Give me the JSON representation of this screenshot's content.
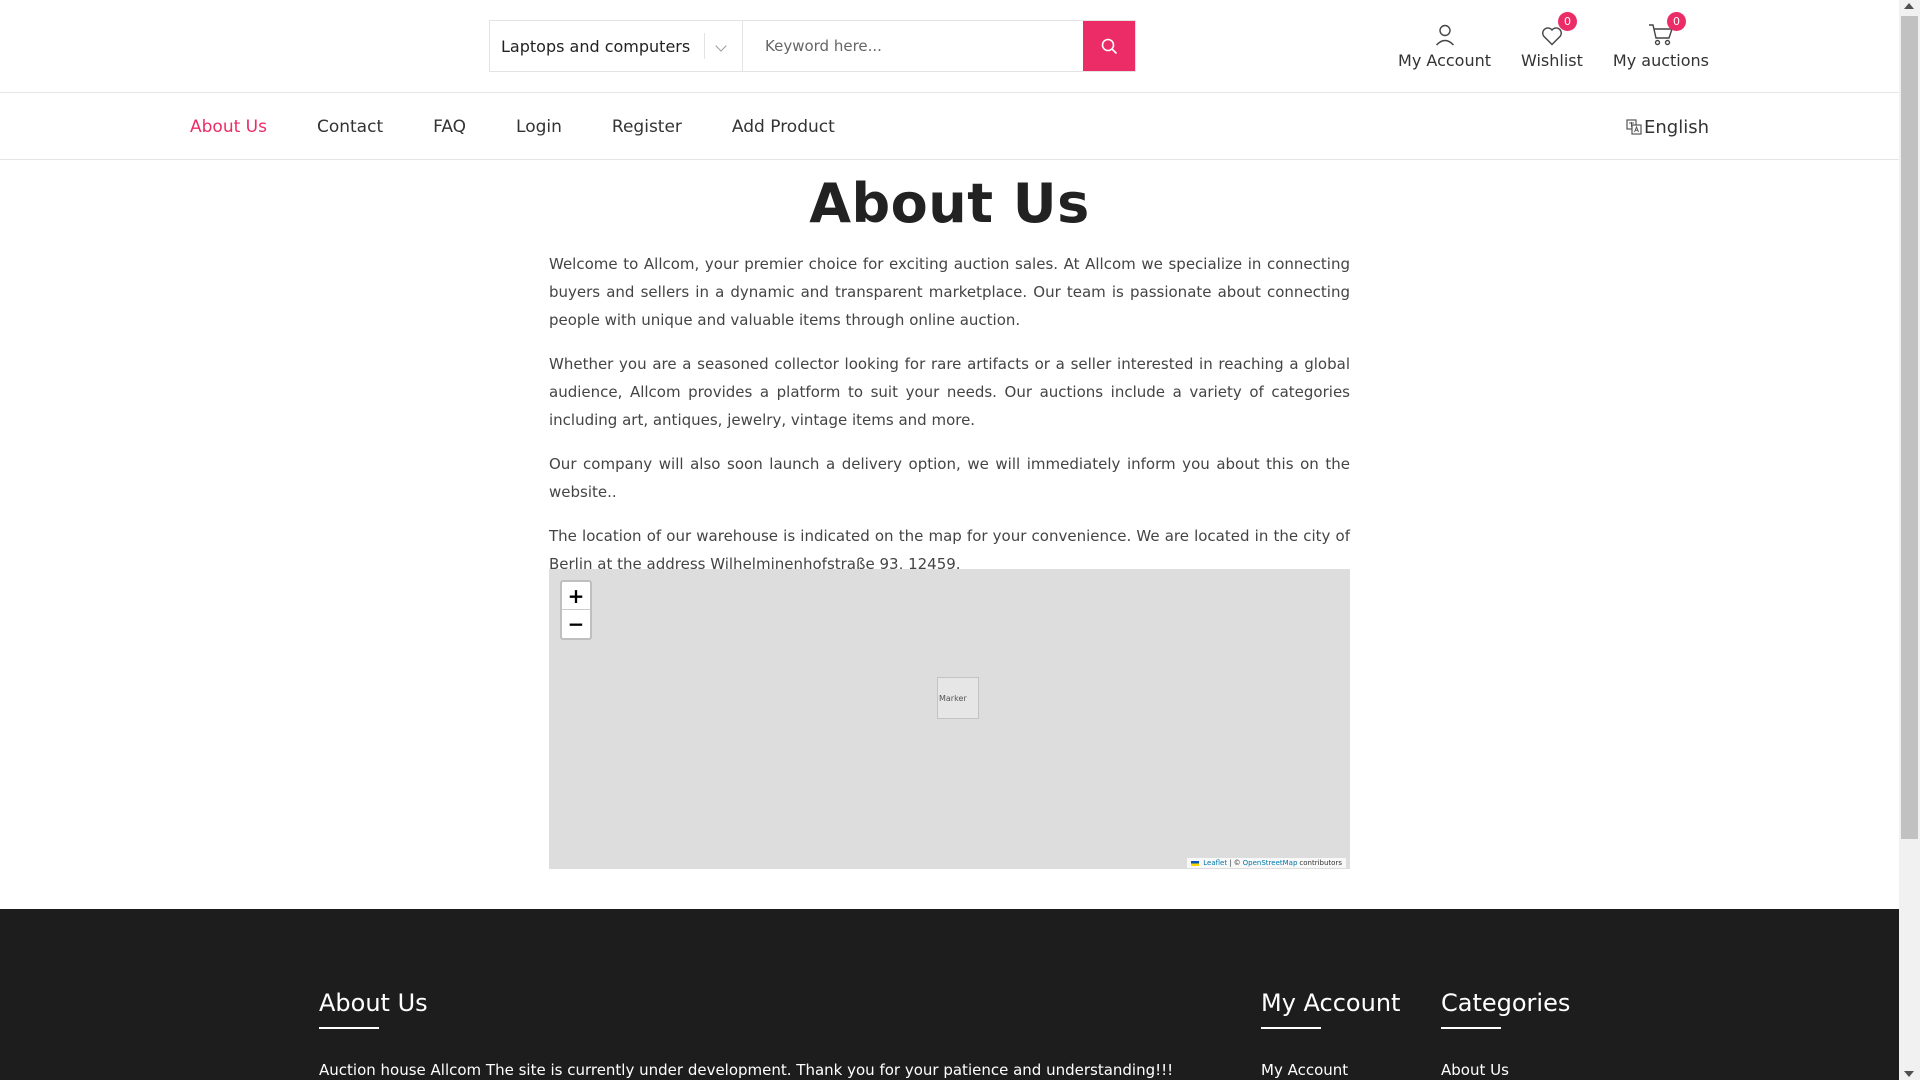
{
  "header": {
    "category_selected": "Laptops and computers",
    "search_placeholder": "Keyword here...",
    "actions": {
      "account_label": "My Account",
      "wishlist_label": "Wishlist",
      "wishlist_count": "0",
      "auctions_label": "My auctions",
      "auctions_count": "0"
    }
  },
  "nav": {
    "items": [
      {
        "label": "About Us",
        "active": true
      },
      {
        "label": "Contact"
      },
      {
        "label": "FAQ"
      },
      {
        "label": "Login"
      },
      {
        "label": "Register"
      },
      {
        "label": "Add Product"
      }
    ],
    "language": "English"
  },
  "main": {
    "title": "About Us",
    "paragraphs": [
      "Welcome to Allcom, your premier choice for exciting auction sales. At Allcom we specialize in connecting buyers and sellers in a dynamic and transparent marketplace. Our team is passionate about connecting people with unique and valuable items through online auction.",
      "Whether you are a seasoned collector looking for rare artifacts or a seller interested in reaching a global audience, Allcom provides a platform to suit your needs. Our auctions include a variety of categories including art, antiques, jewelry, vintage items and more.",
      "Our company will also soon launch a delivery option, we will immediately inform you about this on the website..",
      "The location of our warehouse is indicated on the map for your convenience. We are located in the city of Berlin at the address Wilhelminenhofstraße 93, 12459."
    ]
  },
  "map": {
    "zoom_in": "+",
    "zoom_out": "−",
    "marker_alt": "Marker",
    "attribution": {
      "leaflet": "Leaflet",
      "separator": "| ©",
      "osm": "OpenStreetMap",
      "suffix": "contributors"
    }
  },
  "footer": {
    "about": {
      "title": "About Us",
      "text": "Auction house Allcom The site is currently under development. Thank you for your patience and understanding!!!"
    },
    "account": {
      "title": "My Account",
      "first_link": "My Account"
    },
    "categories": {
      "title": "Categories",
      "first_link": "About Us"
    }
  },
  "colors": {
    "accent": "#ec2c66",
    "footer_bg": "#1d1d1d"
  }
}
